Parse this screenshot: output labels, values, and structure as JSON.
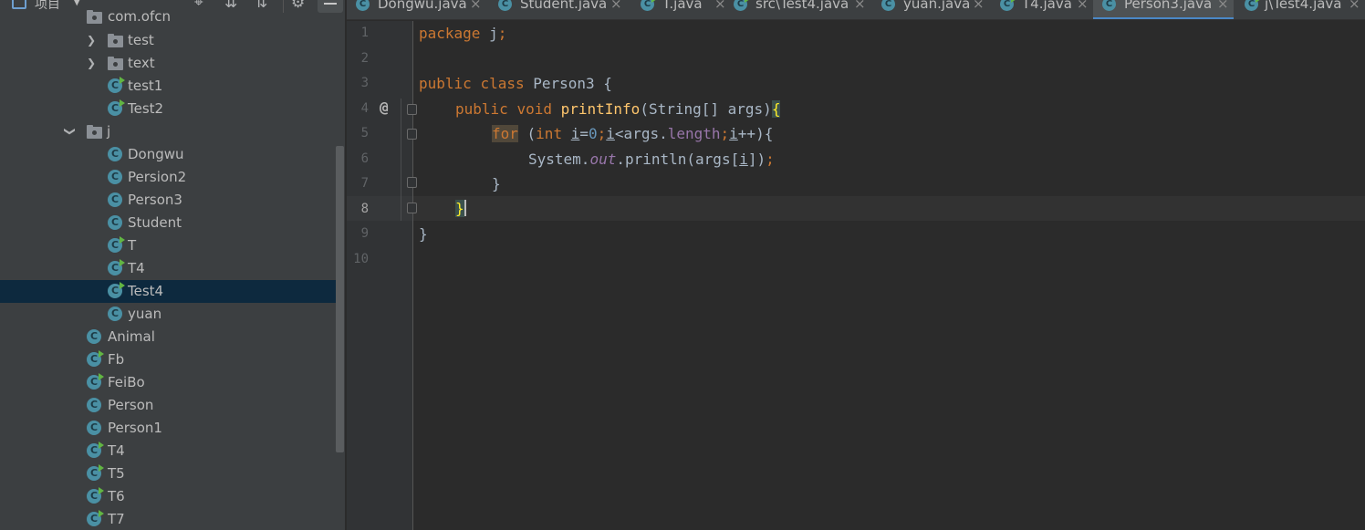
{
  "project_panel": {
    "title": "项目",
    "cut_off_top_item": "com.ofcn",
    "tree": [
      {
        "label": "test",
        "type": "folder",
        "expanded": false
      },
      {
        "label": "text",
        "type": "folder",
        "expanded": false
      },
      {
        "label": "test1",
        "type": "class-runnable"
      },
      {
        "label": "Test2",
        "type": "class-runnable"
      },
      {
        "label": "j",
        "type": "folder",
        "expanded": true
      },
      {
        "label": "Dongwu",
        "type": "class"
      },
      {
        "label": "Persion2",
        "type": "class"
      },
      {
        "label": "Person3",
        "type": "class"
      },
      {
        "label": "Student",
        "type": "class"
      },
      {
        "label": "T",
        "type": "class-runnable"
      },
      {
        "label": "T4",
        "type": "class-runnable"
      },
      {
        "label": "Test4",
        "type": "class-runnable",
        "selected": true
      },
      {
        "label": "yuan",
        "type": "class"
      },
      {
        "label": "Animal",
        "type": "class"
      },
      {
        "label": "Fb",
        "type": "class-runnable"
      },
      {
        "label": "FeiBo",
        "type": "class-runnable"
      },
      {
        "label": "Person",
        "type": "class"
      },
      {
        "label": "Person1",
        "type": "class"
      },
      {
        "label": "T4",
        "type": "class-runnable"
      },
      {
        "label": "T5",
        "type": "class-runnable"
      },
      {
        "label": "T6",
        "type": "class-runnable"
      },
      {
        "label": "T7",
        "type": "class-runnable"
      }
    ]
  },
  "tabs": [
    {
      "label": "Dongwu.java",
      "runnable": false
    },
    {
      "label": "Student.java",
      "runnable": false
    },
    {
      "label": "T.java",
      "runnable": true
    },
    {
      "label": "src\\Test4.java",
      "runnable": true
    },
    {
      "label": "yuan.java",
      "runnable": false
    },
    {
      "label": "T4.java",
      "runnable": true
    },
    {
      "label": "Person3.java",
      "runnable": false,
      "active": true
    },
    {
      "label": "j\\Test4.java",
      "runnable": true
    }
  ],
  "editor": {
    "line_numbers": [
      "1",
      "2",
      "3",
      "4",
      "5",
      "6",
      "7",
      "8",
      "9",
      "10"
    ],
    "current_line": "8",
    "code": {
      "l1_kw": "package",
      "l1_rest": " j",
      "l1_semi": ";",
      "l3_kw1": "public",
      "l3_kw2": "class",
      "l3_rest": " Person3 {",
      "l4_kw1": "public",
      "l4_kw2": "void",
      "l4_fn": "printInfo",
      "l4_rest": "(String[] args)",
      "l4_brace": "{",
      "l5_for": "for",
      "l5_open": " (",
      "l5_int": "int",
      "l5_i1": "i",
      "l5_eq": "=",
      "l5_zero": "0",
      "l5_semi1": ";",
      "l5_i2": "i",
      "l5_lt": "<args.",
      "l5_len": "length",
      "l5_semi2": ";",
      "l5_i3": "i",
      "l5_end": "++){",
      "l6_a": "System.",
      "l6_out": "out",
      "l6_b": ".println(args[",
      "l6_i": "i",
      "l6_c": "])",
      "l6_semi": ";",
      "l7": "}",
      "l8": "}",
      "l9": "}"
    }
  },
  "icons": {
    "class_badge": "C",
    "expand": "›",
    "collapse": "⌄",
    "close": "×",
    "override_marker": "@"
  }
}
